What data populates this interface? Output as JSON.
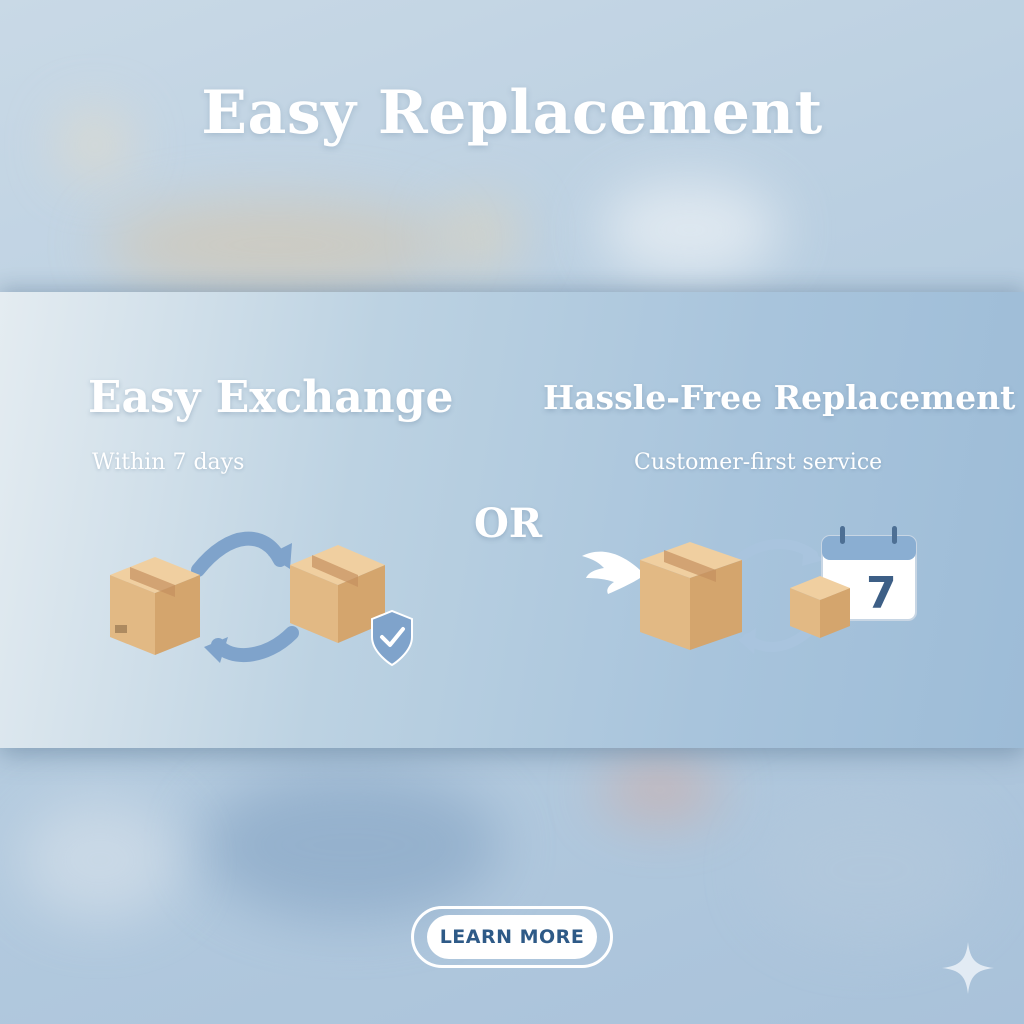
{
  "hero": {
    "title": "Easy Replacement"
  },
  "options": [
    {
      "title": "Easy Exchange",
      "subtitle": "Within 7 days"
    },
    {
      "title": "Hassle-Free Replacement",
      "subtitle": "Customer-first service"
    }
  ],
  "separator": "OR",
  "calendar": {
    "day": "7"
  },
  "cta": {
    "label": "LEARN MORE"
  },
  "colors": {
    "accent": "#2e5a87",
    "box": "#e2b984",
    "arrow": "#7fa3cb"
  },
  "icons": [
    "box-icon",
    "exchange-arrows-icon",
    "shield-check-icon",
    "wing-icon",
    "calendar-icon",
    "sparkle-icon"
  ]
}
